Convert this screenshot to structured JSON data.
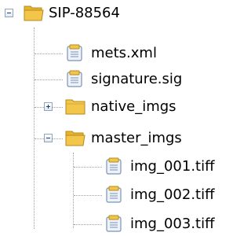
{
  "tree": {
    "root": {
      "label": "SIP-88564",
      "expanded": true,
      "icon": "folder-open-icon",
      "children": [
        {
          "label": "mets.xml",
          "icon": "file-icon"
        },
        {
          "label": "signature.sig",
          "icon": "file-icon"
        },
        {
          "label": "native_imgs",
          "icon": "folder-icon",
          "expanded": false
        },
        {
          "label": "master_imgs",
          "icon": "folder-open-icon",
          "expanded": true,
          "children": [
            {
              "label": "img_001.tiff",
              "icon": "file-icon"
            },
            {
              "label": "img_002.tiff",
              "icon": "file-icon"
            },
            {
              "label": "img_003.tiff",
              "icon": "file-icon"
            }
          ]
        }
      ]
    }
  },
  "colors": {
    "folder": "#f3c64b",
    "file": "#eef3fa",
    "connector": "#a0a0a0"
  }
}
